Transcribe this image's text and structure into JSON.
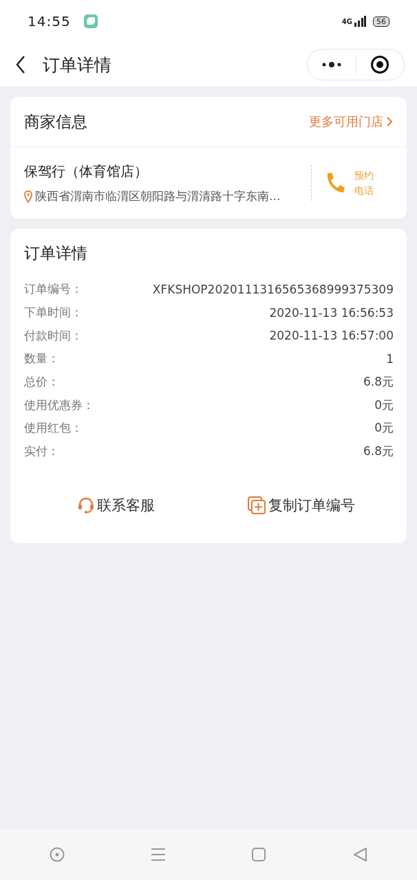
{
  "status_bar": {
    "time": "14:55",
    "network": "4G",
    "battery": "56"
  },
  "header": {
    "title": "订单详情"
  },
  "merchant": {
    "title": "商家信息",
    "more_link": "更多可用门店",
    "name": "保驾行（体育馆店）",
    "address": "陕西省渭南市临渭区朝阳路与渭清路十字东南…",
    "phone_label": "预约电话"
  },
  "order": {
    "title": "订单详情",
    "rows": [
      {
        "label": "订单编号：",
        "value": "XFKSHOP2020111316565368999375309"
      },
      {
        "label": "下单时间：",
        "value": "2020-11-13 16:56:53"
      },
      {
        "label": "付款时间：",
        "value": "2020-11-13 16:57:00"
      },
      {
        "label": "数量：",
        "value": "1"
      },
      {
        "label": "总价：",
        "value": "6.8元"
      },
      {
        "label": "使用优惠券：",
        "value": "0元"
      },
      {
        "label": "使用红包：",
        "value": "0元"
      },
      {
        "label": "实付：",
        "value": "6.8元"
      }
    ],
    "actions": [
      {
        "kind": "service",
        "label": "联系客服"
      },
      {
        "kind": "copy",
        "label": "复制订单编号"
      }
    ]
  }
}
